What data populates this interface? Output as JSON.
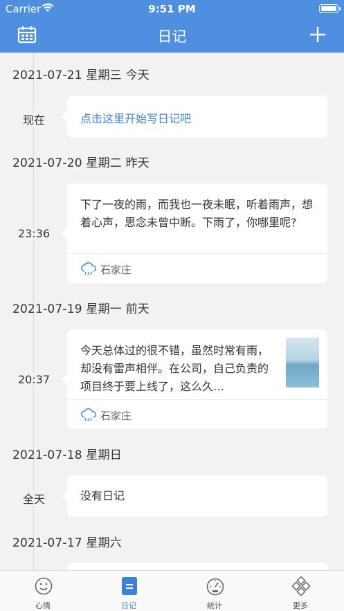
{
  "status_bar": {
    "carrier": "Carrier",
    "time": "9:51 PM"
  },
  "nav": {
    "title": "日记",
    "left_icon": "calendar-icon",
    "right_icon": "plus-icon"
  },
  "days": [
    {
      "date": "2021-07-21 星期三  今天",
      "entry_label": "现在",
      "prompt": "点击这里开始写日记吧"
    },
    {
      "date": "2021-07-20 星期二  昨天",
      "entry_label": "23:36",
      "text": "下了一夜的雨，而我也一夜未眠，听着雨声，想着心声，思念未曾中断。下雨了，你哪里呢?",
      "location": "石家庄",
      "weather_icon": "rain-cloud-icon"
    },
    {
      "date": "2021-07-19 星期一  前天",
      "entry_label": "20:37",
      "text": "今天总体过的很不错，虽然时常有雨，却没有雷声相伴。在公司，自己负责的项目终于要上线了，这么久…",
      "location": "石家庄",
      "weather_icon": "rain-cloud-icon",
      "has_photo": true
    },
    {
      "date": "2021-07-18 星期日",
      "entry_label": "全天",
      "text": "没有日记"
    },
    {
      "date": "2021-07-17 星期六"
    }
  ],
  "tabs": [
    {
      "label": "心情",
      "icon": "smiley-icon"
    },
    {
      "label": "日记",
      "icon": "diary-icon",
      "active": true
    },
    {
      "label": "统计",
      "icon": "gauge-icon"
    },
    {
      "label": "更多",
      "icon": "grid-diamond-icon"
    }
  ],
  "colors": {
    "primary": "#4e8fe0",
    "link": "#3d82d8",
    "background": "#f2f2f2"
  }
}
